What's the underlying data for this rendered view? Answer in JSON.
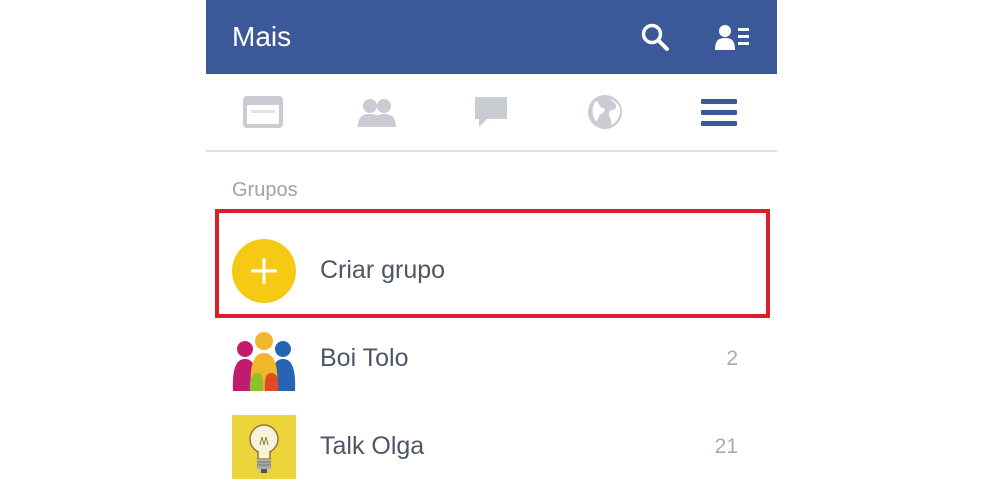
{
  "header": {
    "title": "Mais",
    "background_color": "#3b5998",
    "actions": [
      {
        "icon": "search-icon"
      },
      {
        "icon": "friend-requests-icon"
      }
    ]
  },
  "nav": {
    "tabs": [
      {
        "icon": "news-feed-icon",
        "active": false
      },
      {
        "icon": "friends-icon",
        "active": false
      },
      {
        "icon": "messages-icon",
        "active": false
      },
      {
        "icon": "globe-icon",
        "active": false
      },
      {
        "icon": "menu-icon",
        "active": true
      }
    ],
    "active_color": "#3b5998",
    "inactive_color": "#c9ccd2"
  },
  "groups": {
    "section_title": "Grupos",
    "create": {
      "label": "Criar grupo",
      "icon": "plus-icon",
      "color": "#f6c915"
    },
    "highlight_color": "#d8202a",
    "items": [
      {
        "name": "Boi Tolo",
        "count": "2",
        "thumbnail": "people-silhouettes-icon"
      },
      {
        "name": "Talk Olga",
        "count": "21",
        "thumbnail": "lightbulb-icon"
      }
    ]
  }
}
